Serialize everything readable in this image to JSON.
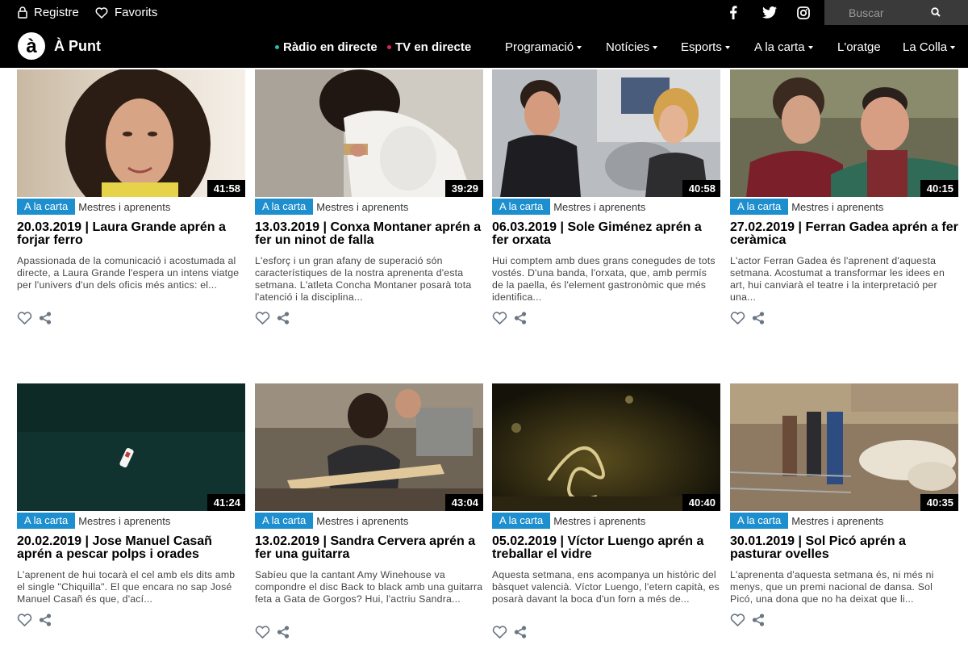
{
  "topbar": {
    "register_label": "Registre",
    "favorites_label": "Favorits",
    "search_placeholder": "Buscar"
  },
  "nav": {
    "brand": "À Punt",
    "live_radio": "Ràdio en directe",
    "live_tv": "TV en directe",
    "items": [
      "Programació",
      "Notícies",
      "Esports",
      "A la carta",
      "L'oratge",
      "La Colla"
    ]
  },
  "colors": {
    "bar_bg": "#000000",
    "tag_blue": "#1e8fce",
    "radio_dot": "#22c0b5",
    "tv_dot": "#e0245e"
  },
  "icons": [
    "user-icon",
    "heart-icon",
    "facebook-icon",
    "twitter-icon",
    "instagram-icon",
    "search-icon",
    "logo-icon",
    "share-icon"
  ],
  "cards": [
    {
      "tag": "A la carta",
      "program": "Mestres i aprenents",
      "duration": "41:58",
      "title": "20.03.2019 | Laura Grande aprén a forjar ferro",
      "desc": "Apassionada de la comunicació i acostumada al directe, a Laura Grande l'espera un intens viatge per l'univers d'un dels oficis més antics: el..."
    },
    {
      "tag": "A la carta",
      "program": "Mestres i aprenents",
      "duration": "39:29",
      "title": "13.03.2019 | Conxa Montaner aprén a fer un ninot de falla",
      "desc": "L'esforç i un gran afany de superació són característiques de la nostra aprenenta d'esta setmana. L'atleta Concha Montaner posarà tota l'atenció i la disciplina..."
    },
    {
      "tag": "A la carta",
      "program": "Mestres i aprenents",
      "duration": "40:58",
      "title": "06.03.2019 | Sole Giménez aprén a fer orxata",
      "desc": "Hui comptem amb dues grans conegudes de tots vostés. D'una banda, l'orxata, que, amb permís de la paella, és l'element gastronòmic que més identifica..."
    },
    {
      "tag": "A la carta",
      "program": "Mestres i aprenents",
      "duration": "40:15",
      "title": "27.02.2019 | Ferran Gadea aprén a fer ceràmica",
      "desc": "L'actor Ferran Gadea és l'aprenent d'aquesta setmana. Acostumat a transformar les idees en art, hui canviarà el teatre i la interpretació per una..."
    },
    {
      "tag": "A la carta",
      "program": "Mestres i aprenents",
      "duration": "41:24",
      "title": "20.02.2019 | Jose Manuel Casañ aprén a pescar polps i orades",
      "desc": "L'aprenent de hui tocarà el cel amb els dits amb el single \"Chiquilla\". El que encara no sap José Manuel Casañ és que, d'ací..."
    },
    {
      "tag": "A la carta",
      "program": "Mestres i aprenents",
      "duration": "43:04",
      "title": "13.02.2019 | Sandra Cervera aprén a fer una guitarra",
      "desc": "Sabíeu que la cantant Amy Winehouse va compondre el disc Back to black amb una guitarra feta a Gata de Gorgos? Hui, l'actriu Sandra..."
    },
    {
      "tag": "A la carta",
      "program": "Mestres i aprenents",
      "duration": "40:40",
      "title": "05.02.2019 | Víctor Luengo aprén a treballar el vidre",
      "desc": "Aquesta setmana, ens acompanya un històric del bàsquet valencià. Víctor Luengo, l'etern capità, es posarà davant la boca d'un forn a més de..."
    },
    {
      "tag": "A la carta",
      "program": "Mestres i aprenents",
      "duration": "40:35",
      "title": "30.01.2019 | Sol Picó aprén a pasturar ovelles",
      "desc": "L'aprenenta d'aquesta setmana és, ni més ni menys, que un premi nacional de dansa. Sol Picó, una dona que no ha deixat que li..."
    }
  ]
}
